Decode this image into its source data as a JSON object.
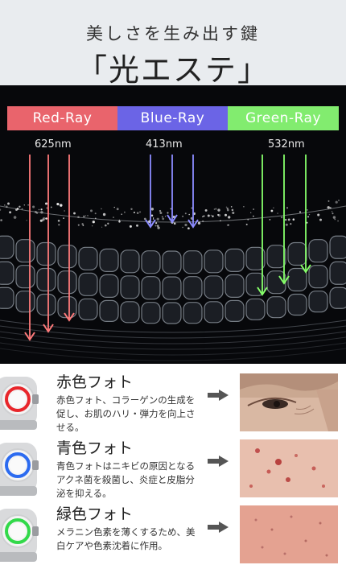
{
  "header": {
    "subtitle": "美しさを生み出す鍵",
    "headline": "「光エステ」"
  },
  "rays": [
    {
      "label": "Red-Ray",
      "wavelength": "625nm",
      "color": "#e9646c",
      "arrow_color": "#ff7a7a"
    },
    {
      "label": "Blue-Ray",
      "wavelength": "413nm",
      "color": "#6b64e6",
      "arrow_color": "#8c8cff"
    },
    {
      "label": "Green-Ray",
      "wavelength": "532nm",
      "color": "#82ec6f",
      "arrow_color": "#86ff6a"
    }
  ],
  "items": [
    {
      "title": "赤色フォト",
      "description": "赤色フォト、コラーゲンの生成を促し、お肌のハリ・弾力を向上させる。",
      "ring_color": "#e8262b",
      "icon": "right-arrow-icon"
    },
    {
      "title": "青色フォト",
      "description": "青色フォトはニキビの原因となるアクネ菌を殺菌し、炎症と皮脂分泌を抑える。",
      "ring_color": "#2c6bf0",
      "icon": "right-arrow-icon"
    },
    {
      "title": "緑色フォト",
      "description": "メラニン色素を薄くするため、美白ケアや色素沈着に作用。",
      "ring_color": "#32d94a",
      "icon": "right-arrow-icon"
    }
  ]
}
